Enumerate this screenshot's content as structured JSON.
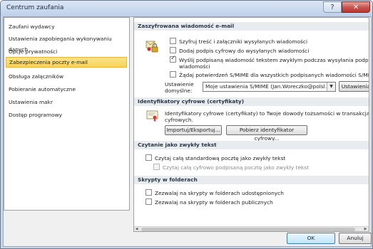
{
  "window": {
    "title": "Centrum zaufania",
    "help_glyph": "?",
    "close_glyph": "✕"
  },
  "sidebar": {
    "items": [
      {
        "label": "Zaufani wydawcy",
        "active": false
      },
      {
        "label": "Ustawienia zapobiegania wykonywaniu danych",
        "active": false
      },
      {
        "label": "Opcje prywatności",
        "active": false
      },
      {
        "label": "Zabezpieczenia poczty e-mail",
        "active": true
      },
      {
        "label": "Obsługa załączników",
        "active": false
      },
      {
        "label": "Pobieranie automatyczne",
        "active": false
      },
      {
        "label": "Ustawienia makr",
        "active": false
      },
      {
        "label": "Dostęp programowy",
        "active": false
      }
    ]
  },
  "encrypted": {
    "header": "Zaszyfrowana wiadomość e-mail",
    "icon": "lock-envelope-icon",
    "options": [
      {
        "label": "Szyfruj treść i załączniki wysyłanych wiadomości",
        "checked": false
      },
      {
        "label": "Dodaj podpis cyfrowy do wysyłanych wiadomości",
        "checked": false
      },
      {
        "label": "Wyślij podpisaną wiadomość tekstem zwykłym podczas wysyłania podpisanych",
        "label2": "wiadomości",
        "checked": true
      },
      {
        "label": "Żądaj potwierdzeń S/MIME dla wszystkich podpisanych wiadomości S/MIME",
        "checked": false
      }
    ],
    "default_settings_label": "Ustawienie",
    "default_settings_label2": "domyślne:",
    "default_settings_value": "Moje ustawienia S/MIME (Jan.Woreczko@polsl.pl)",
    "settings_button": "Ustawienia"
  },
  "certs": {
    "header": "Identyfikatory cyfrowe (certyfikaty)",
    "icon": "certificate-icon",
    "description": "Identyfikatory cyfrowe (certyfikaty) to Twoje dowody tożsamości w transakcjach",
    "description2": "cyfrowych.",
    "import_button": "Importuj/Eksportuj...",
    "get_button": "Pobierz identyfikator cyfrowy..."
  },
  "plaintext": {
    "header": "Czytanie jako zwykły tekst",
    "options": [
      {
        "label": "Czytaj całą standardową pocztę jako zwykły tekst",
        "checked": false,
        "disabled": false
      },
      {
        "label": "Czytaj całą cyfrowo podpisaną pocztę jako zwykły tekst",
        "checked": false,
        "disabled": true
      }
    ]
  },
  "scripts": {
    "header": "Skrypty w folderach",
    "options": [
      {
        "label": "Zezwalaj na skrypty w folderach udostępnionych",
        "checked": false
      },
      {
        "label": "Zezwalaj na skrypty w folderach publicznych",
        "checked": false
      }
    ]
  },
  "footer": {
    "ok": "OK",
    "cancel": "Anuluj"
  }
}
